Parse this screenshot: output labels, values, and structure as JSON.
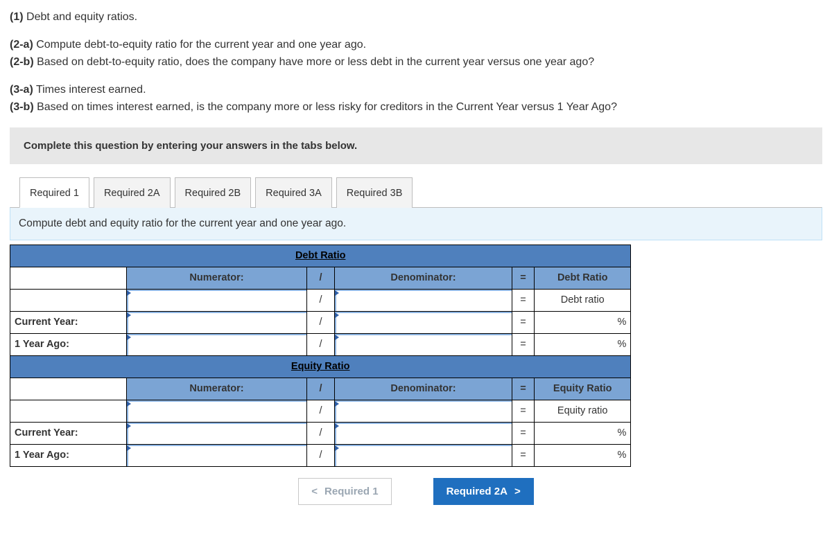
{
  "prompt": {
    "p1_label": "(1)",
    "p1_text": " Debt and equity ratios.",
    "p2a_label": "(2-a)",
    "p2a_text": " Compute debt-to-equity ratio for the current year and one year ago.",
    "p2b_label": "(2-b)",
    "p2b_text": " Based on debt-to-equity ratio, does the company have more or less debt in the current year versus one year ago?",
    "p3a_label": "(3-a)",
    "p3a_text": " Times interest earned.",
    "p3b_label": "(3-b)",
    "p3b_text": " Based on times interest earned, is the company more or less risky for creditors in the Current Year versus 1 Year Ago?"
  },
  "instruction": "Complete this question by entering your answers in the tabs below.",
  "tabs": [
    "Required 1",
    "Required 2A",
    "Required 2B",
    "Required 3A",
    "Required 3B"
  ],
  "active_tab_index": 0,
  "tab_description": "Compute debt and equity ratio for the current year and one year ago.",
  "table": {
    "section1": "Debt Ratio",
    "section2": "Equity Ratio",
    "numerator": "Numerator:",
    "denominator": "Denominator:",
    "slash": "/",
    "eq": "=",
    "result1_header": "Debt Ratio",
    "result1_sub": "Debt ratio",
    "result2_header": "Equity Ratio",
    "result2_sub": "Equity ratio",
    "row_current": "Current Year:",
    "row_prior": "1 Year Ago:",
    "pct": "%"
  },
  "nav": {
    "prev": "Required 1",
    "next": "Required 2A",
    "chev_left": "<",
    "chev_right": ">"
  }
}
